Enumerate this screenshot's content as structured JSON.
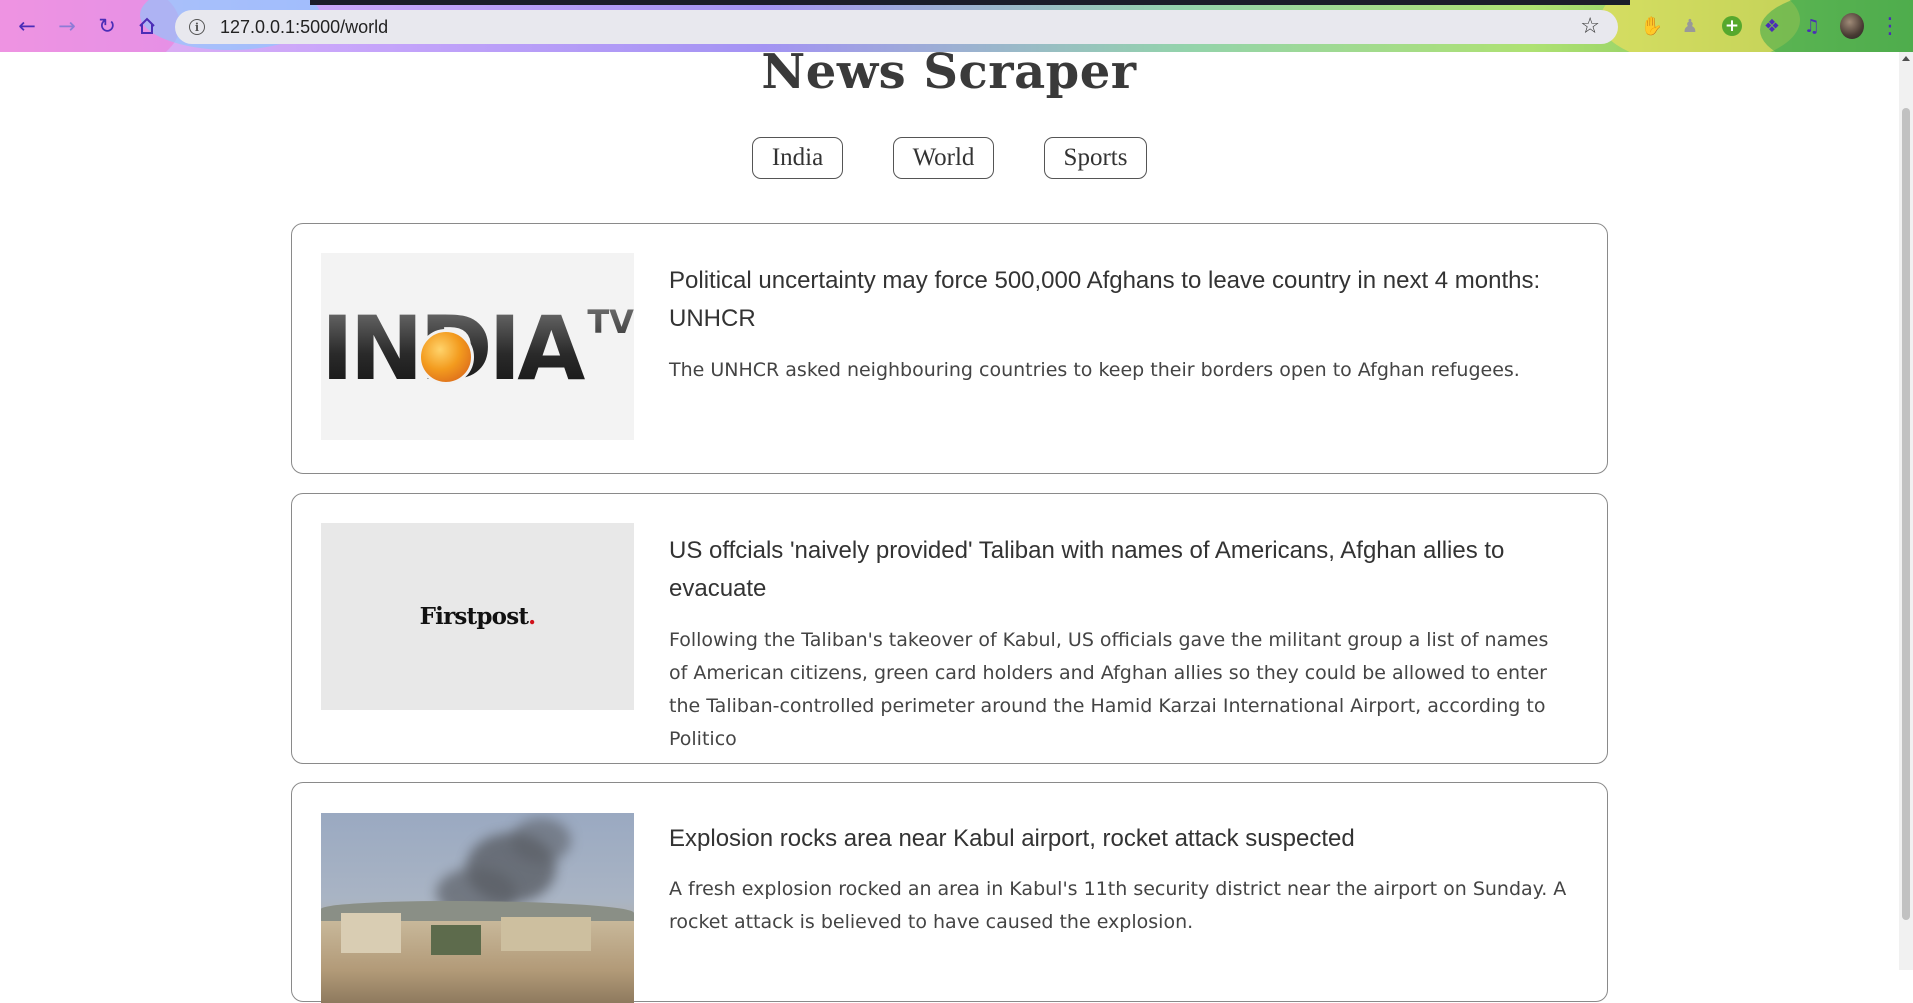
{
  "browser": {
    "url": "127.0.0.1:5000/world",
    "icons": [
      "back-icon",
      "forward-icon",
      "reload-icon",
      "home-icon",
      "info-icon",
      "star-icon",
      "extension-hand-icon",
      "extension-figure-icon",
      "extension-plus-icon",
      "extensions-puzzle-icon",
      "media-queue-icon",
      "profile-avatar",
      "menu-dots-icon"
    ],
    "accent": "#4b2db7"
  },
  "page": {
    "title": "News Scraper",
    "categories": [
      "India",
      "World",
      "Sports"
    ]
  },
  "articles": [
    {
      "title": "Political uncertainty may force 500,000 Afghans to leave country in next 4 months: UNHCR",
      "description": "The UNHCR asked neighbouring countries to keep their borders open to Afghan refugees.",
      "image": {
        "type": "logo",
        "logo_text": "INDIA",
        "logo_sup": "TV"
      }
    },
    {
      "title": "US offcials 'naively provided' Taliban with names of Americans, Afghan allies to evacuate",
      "description": "Following the Taliban's takeover of Kabul, US officials gave the militant group a list of names of American citizens, green card holders and Afghan allies so they could be allowed to enter the Taliban-controlled perimeter around the Hamid Karzai International Airport, according to Politico",
      "image": {
        "type": "logo",
        "logo_text": "Firstpost",
        "logo_dot": "."
      }
    },
    {
      "title": "Explosion rocks area near Kabul airport, rocket attack suspected",
      "description": "A fresh explosion rocked an area in Kabul's 11th security district near the airport on Sunday. A rocket attack is believed to have caused the explosion.",
      "image": {
        "type": "photo"
      }
    }
  ]
}
